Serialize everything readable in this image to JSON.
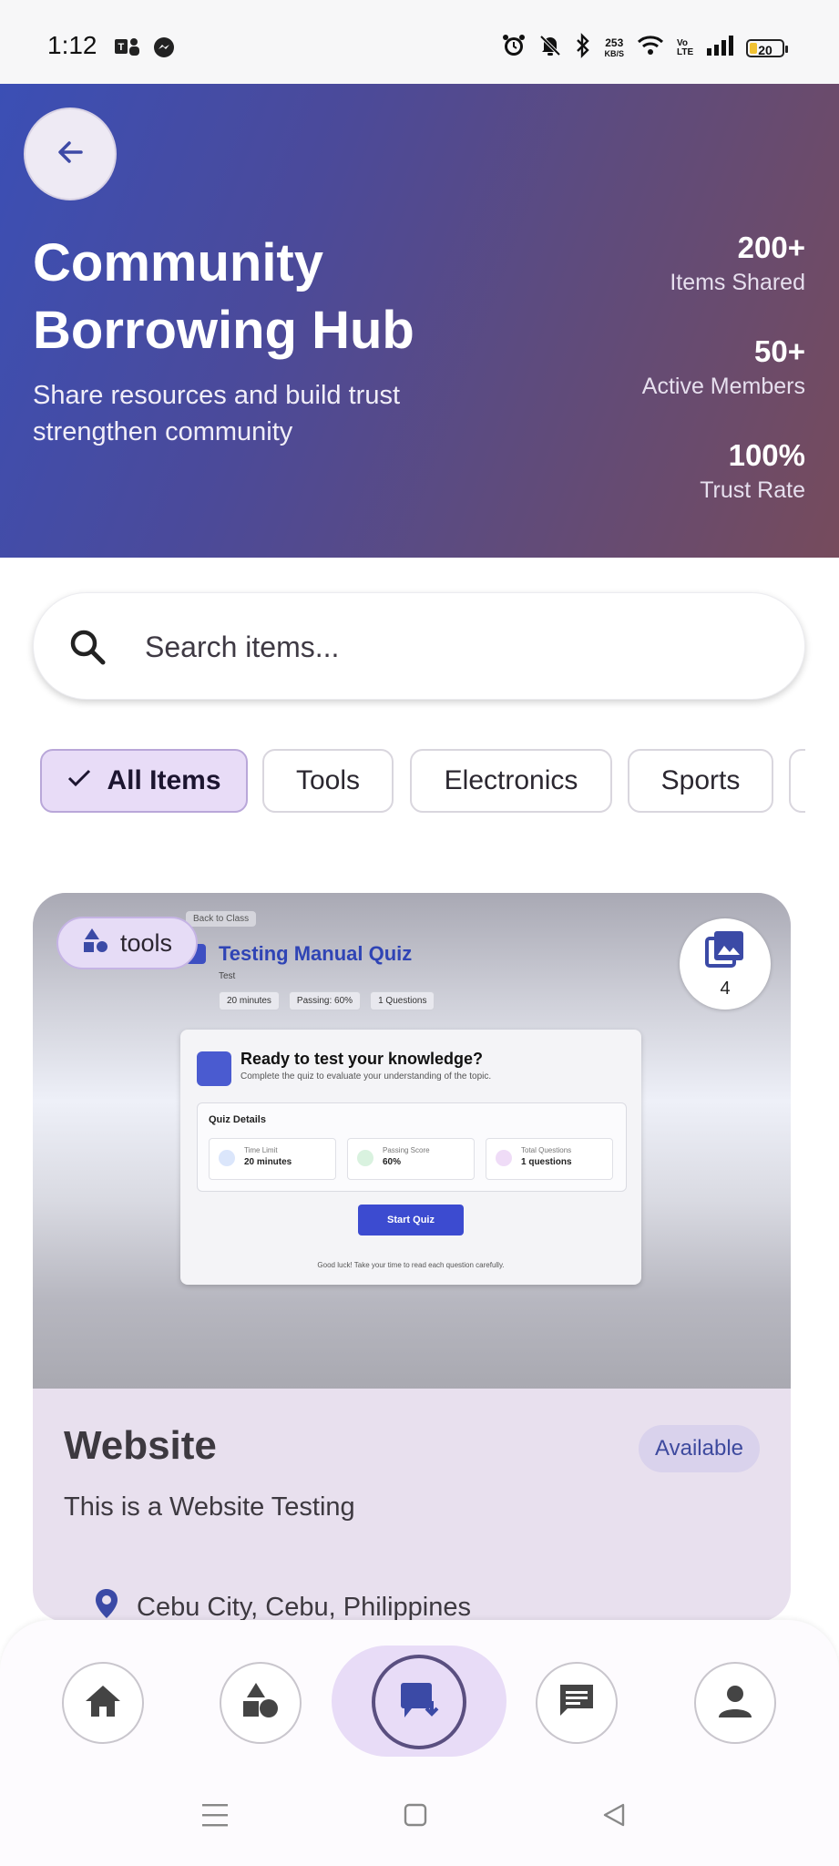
{
  "status_bar": {
    "time": "1:12",
    "speed_value": "253",
    "speed_unit": "KB/S",
    "network_label": "Vo LTE",
    "battery": "20",
    "icons": [
      "teams-icon",
      "messenger-icon",
      "alarm-icon",
      "mute-icon",
      "bluetooth-icon",
      "wifi-icon",
      "signal-icon",
      "battery-icon"
    ]
  },
  "hero": {
    "title": "Community Borrowing Hub",
    "subtitle": "Share resources and build trust strengthen community",
    "stats": [
      {
        "value": "200+",
        "label": "Items Shared"
      },
      {
        "value": "50+",
        "label": "Active Members"
      },
      {
        "value": "100%",
        "label": "Trust Rate"
      }
    ]
  },
  "search": {
    "placeholder": "Search items..."
  },
  "filters": {
    "chips": [
      {
        "label": "All Items",
        "selected": true
      },
      {
        "label": "Tools",
        "selected": false
      },
      {
        "label": "Electronics",
        "selected": false
      },
      {
        "label": "Sports",
        "selected": false
      }
    ]
  },
  "card": {
    "tag": "tools",
    "image_count": "4",
    "title": "Website",
    "status": "Available",
    "description": "This is a Website Testing",
    "location": "Cebu City, Cebu, Philippines",
    "preview": {
      "back": "Back to Class",
      "title": "Testing Manual Quiz",
      "subtitle": "Test",
      "pills": [
        "20 minutes",
        "Passing: 60%",
        "1 Questions"
      ],
      "heading": "Ready to test your knowledge?",
      "subheading": "Complete the quiz to evaluate your understanding of the topic.",
      "details_title": "Quiz Details",
      "details": [
        {
          "key": "Time Limit",
          "value": "20 minutes"
        },
        {
          "key": "Passing Score",
          "value": "60%"
        },
        {
          "key": "Total Questions",
          "value": "1 questions"
        }
      ],
      "start": "Start Quiz",
      "footer": "Good luck! Take your time to read each question carefully."
    }
  },
  "colors": {
    "hero_start": "#3b4fb5",
    "hero_end": "#764b5c",
    "chip_selected": "#e8dcf7",
    "badge_text": "#3e4a9e"
  },
  "bottom_nav": [
    "home-icon",
    "categories-icon",
    "borrow-icon",
    "chat-icon",
    "profile-icon"
  ]
}
